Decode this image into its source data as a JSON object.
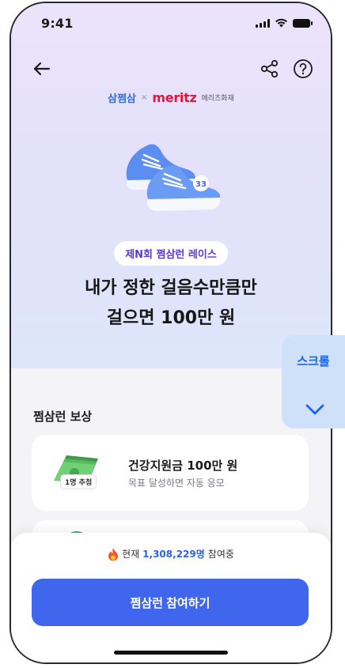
{
  "status_bar": {
    "time": "9:41"
  },
  "nav": {
    "back_icon": "arrow-left-icon",
    "share_icon": "share-icon",
    "help_icon": "help-circle-icon"
  },
  "brand": {
    "left": "삼쩜삼",
    "separator": "×",
    "right": "meritz",
    "right_sub": "메리츠화재"
  },
  "hero": {
    "badge": "제N회 쩜삼런 레이스",
    "headline_line1": "내가 정한 걸음수만큼만",
    "headline_line2": "걸으면 100만 원"
  },
  "rewards": {
    "section_title": "쩜삼런 보상",
    "items": [
      {
        "title": "건강지원금 100만 원",
        "desc": "목표 달성하면 자동 응모",
        "badge": "1명 추첨"
      }
    ]
  },
  "scroll_hint": {
    "label": "스크롤"
  },
  "bottom": {
    "participants_prefix": "현재",
    "participants_count": "1,308,229명",
    "participants_suffix": "참여중",
    "cta_label": "쩜삼런 참여하기"
  },
  "colors": {
    "accent": "#3f66ec",
    "badge_text": "#5b39d9",
    "meritz_red": "#e2173b",
    "samjjeom_blue": "#2b6cf3"
  }
}
